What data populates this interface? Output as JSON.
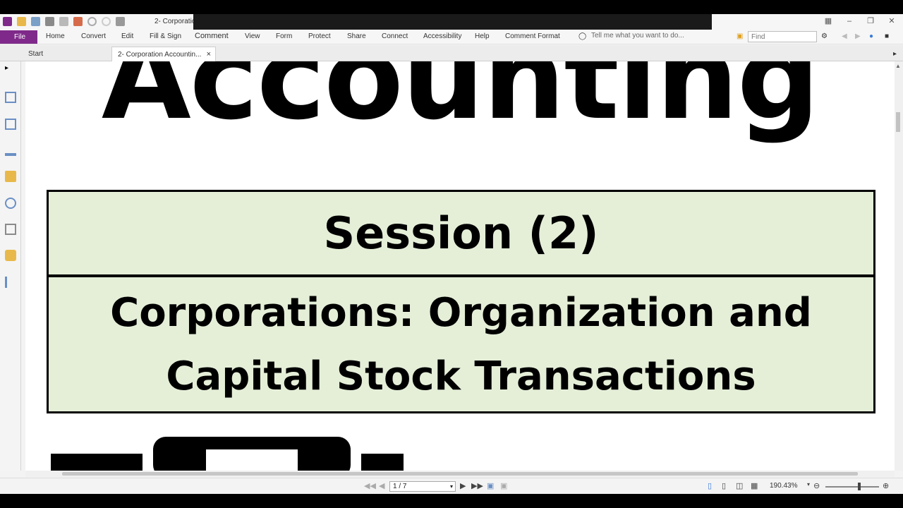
{
  "window": {
    "doc_title": "2- Corporation Accounting"
  },
  "menu": {
    "file": "File",
    "items": [
      "Home",
      "Convert",
      "Edit",
      "Fill & Sign",
      "Comment",
      "View",
      "Form",
      "Protect",
      "Share",
      "Connect",
      "Accessibility",
      "Help",
      "Comment Format"
    ],
    "tell_me": "Tell me what you want to do...",
    "find_placeholder": "Find"
  },
  "tabs": {
    "start": "Start",
    "document": "2- Corporation Accountin...",
    "close_glyph": "×"
  },
  "document": {
    "heading": "Accounting",
    "session": "Session (2)",
    "topic_line1": "Corporations: Organization and",
    "topic_line2": "Capital Stock Transactions"
  },
  "statusbar": {
    "page": "1 / 7",
    "zoom": "190.43%"
  },
  "colors": {
    "file_tab": "#7f2a8a",
    "box_fill": "#e5efd8"
  }
}
